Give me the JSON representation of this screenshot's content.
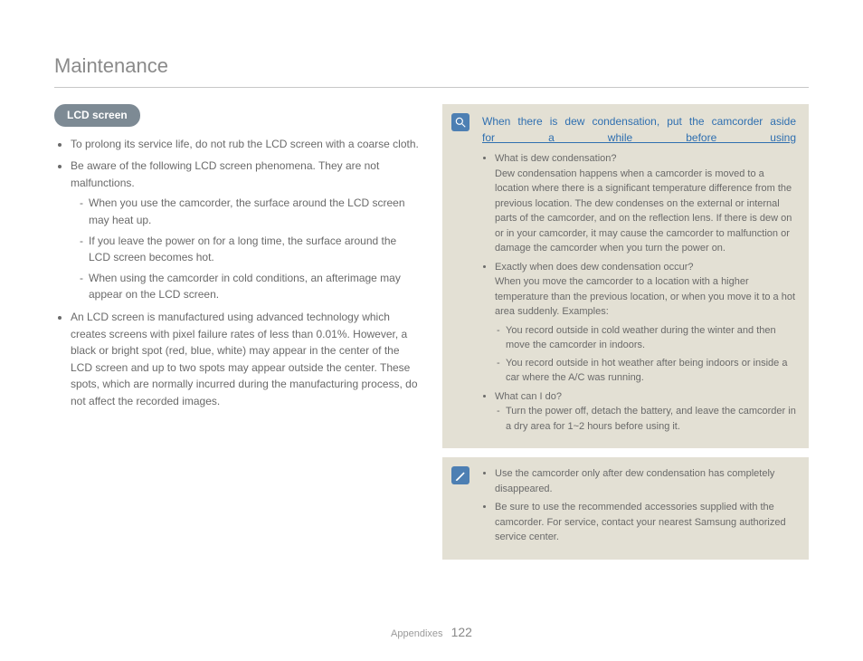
{
  "page": {
    "title": "Maintenance",
    "footer_section": "Appendixes",
    "page_number": "122"
  },
  "left": {
    "badge": "LCD screen",
    "bullets": {
      "b1": "To prolong its service life, do not rub the LCD screen with a coarse cloth.",
      "b2": "Be aware of the following LCD screen phenomena. They are not malfunctions.",
      "b2_sub": {
        "s1": "When you use the camcorder, the surface around the LCD screen may heat up.",
        "s2": "If you leave the power on for a long time, the surface around the LCD screen becomes hot.",
        "s3": "When using the camcorder in cold conditions, an afterimage may appear on the LCD screen."
      },
      "b3": "An LCD screen is manufactured using advanced technology which creates screens with pixel failure rates of less than 0.01%. However, a black or bright spot (red, blue, white) may appear in the center of the LCD screen and up to two spots may appear outside the center. These spots, which are normally incurred during the manufacturing process, do not affect the recorded images."
    }
  },
  "right": {
    "box1": {
      "title_line1": "When there is dew condensation, put the camcorder aside",
      "title_line2": "for a while before using",
      "q1": "What is dew condensation?",
      "q1_desc": "Dew condensation happens when a camcorder is moved to a location where there is a significant temperature difference from the previous location. The dew condenses on the external or internal parts of the camcorder, and on the reflection lens. If there is dew on or in your camcorder, it may cause the camcorder to malfunction or damage the camcorder when you turn the power on.",
      "q2": "Exactly when does dew condensation occur?",
      "q2_desc": "When you move the camcorder to a location with a higher temperature than the previous location, or when you move it to a hot area suddenly. Examples:",
      "q2_dash": {
        "d1": "You record outside in cold weather during the winter and then move the camcorder in indoors.",
        "d2": "You record outside in hot weather after being indoors or inside a car where the A/C was running."
      },
      "q3": "What can I do?",
      "q3_dash": {
        "d1": "Turn the power off, detach the battery, and leave the camcorder in a dry area for 1~2 hours before using it."
      }
    },
    "box2": {
      "b1": "Use the camcorder only after dew condensation has completely disappeared.",
      "b2": "Be sure to use the recommended accessories supplied with the camcorder. For service, contact your nearest Samsung authorized service center."
    }
  }
}
